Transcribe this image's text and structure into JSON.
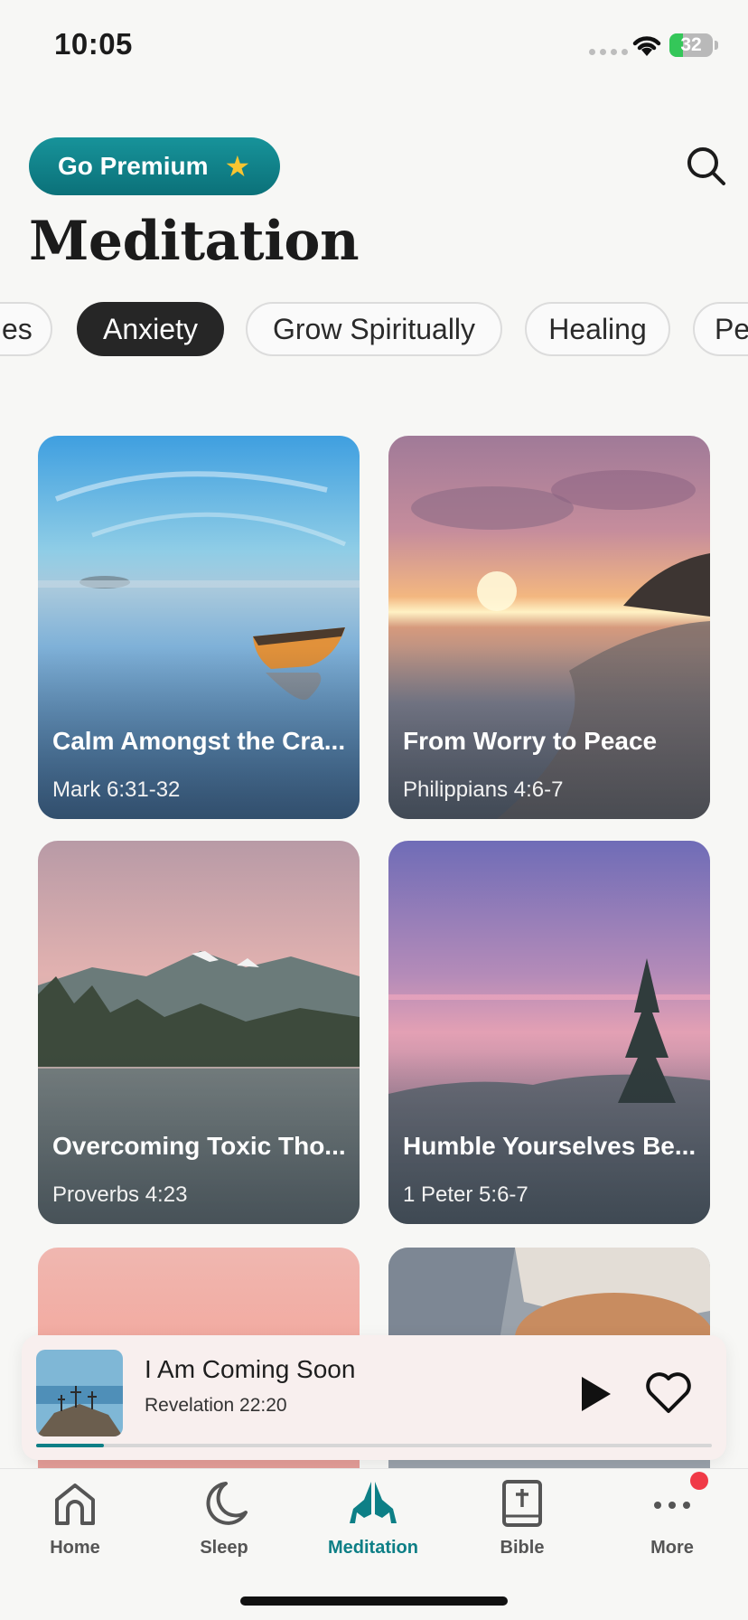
{
  "status_bar": {
    "time": "10:05",
    "battery": "32",
    "battery_level": 0.32
  },
  "header": {
    "premium_label": "Go Premium",
    "title": "Meditation"
  },
  "categories": [
    {
      "label": "es",
      "active": false
    },
    {
      "label": "Anxiety",
      "active": true
    },
    {
      "label": "Grow Spiritually",
      "active": false
    },
    {
      "label": "Healing",
      "active": false
    },
    {
      "label": "Pe",
      "active": false
    }
  ],
  "cards": [
    {
      "title": "Calm Amongst the Cra...",
      "subtitle": "Mark 6:31-32",
      "scene": "misty-lake-boat"
    },
    {
      "title": "From Worry to Peace",
      "subtitle": "Philippians 4:6-7",
      "scene": "beach-sunset"
    },
    {
      "title": "Overcoming Toxic Tho...",
      "subtitle": "Proverbs 4:23",
      "scene": "mountain-lake"
    },
    {
      "title": "Humble Yourselves Be...",
      "subtitle": "1 Peter 5:6-7",
      "scene": "pine-dusk"
    },
    {
      "title": "",
      "subtitle": "",
      "scene": "pink-sky"
    },
    {
      "title": "",
      "subtitle": "",
      "scene": "sleeping-dog"
    }
  ],
  "player": {
    "title": "I Am Coming Soon",
    "subtitle": "Revelation 22:20",
    "progress": 0.1
  },
  "tabs": [
    {
      "label": "Home",
      "icon": "home-icon",
      "active": false
    },
    {
      "label": "Sleep",
      "icon": "moon-icon",
      "active": false
    },
    {
      "label": "Meditation",
      "icon": "praying-hands-icon",
      "active": true
    },
    {
      "label": "Bible",
      "icon": "bible-icon",
      "active": false
    },
    {
      "label": "More",
      "icon": "more-icon",
      "active": false
    }
  ],
  "colors": {
    "accent": "#0d7f86",
    "premium": "#0f8189",
    "notification": "#f03a47"
  }
}
